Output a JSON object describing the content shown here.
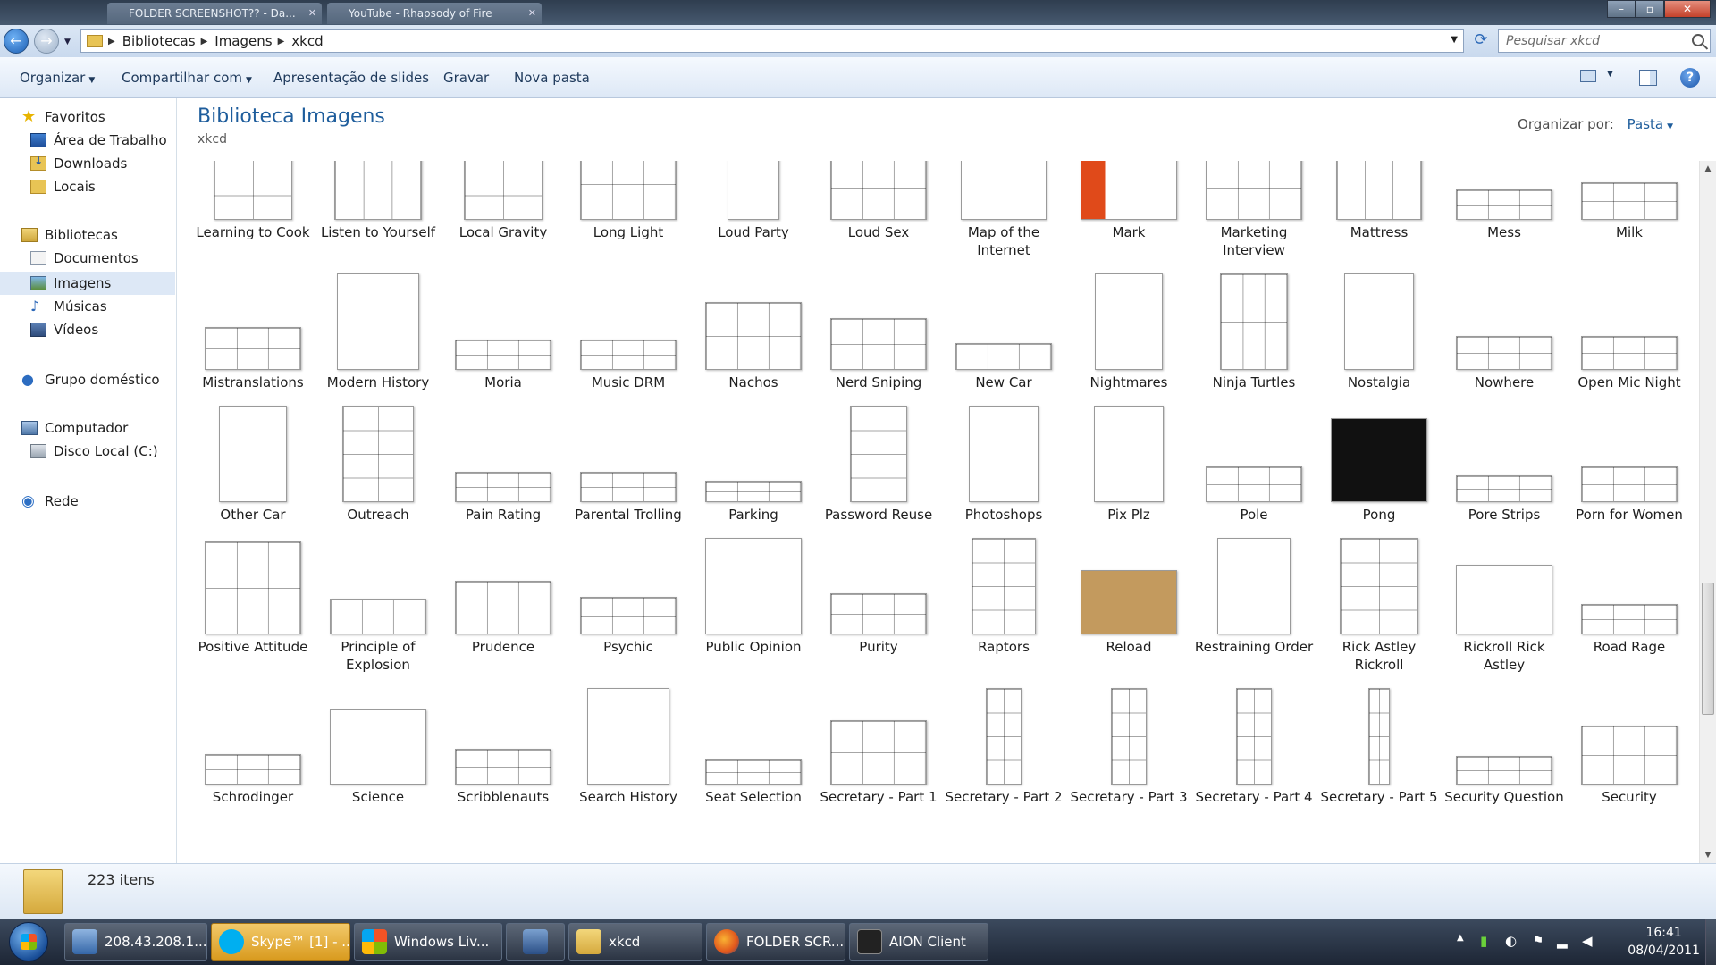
{
  "browser_tabs": [
    {
      "label": "FOLDER SCREENSHOT?? - Da..."
    },
    {
      "label": "YouTube - Rhapsody of Fire"
    }
  ],
  "address": {
    "crumbs": [
      "Bibliotecas",
      "Imagens",
      "xkcd"
    ],
    "search_placeholder": "Pesquisar xkcd"
  },
  "toolbar": {
    "organize": "Organizar",
    "share": "Compartilhar com",
    "slideshow": "Apresentação de slides",
    "burn": "Gravar",
    "new_folder": "Nova pasta"
  },
  "sidebar": {
    "favorites": "Favoritos",
    "desktop": "Área de Trabalho",
    "downloads": "Downloads",
    "places": "Locais",
    "libraries": "Bibliotecas",
    "documents": "Documentos",
    "images": "Imagens",
    "music": "Músicas",
    "videos": "Vídeos",
    "homegroup": "Grupo doméstico",
    "computer": "Computador",
    "local_disk": "Disco Local (C:)",
    "network": "Rede"
  },
  "header": {
    "title": "Biblioteca Imagens",
    "subtitle": "xkcd",
    "arrange_label": "Organizar por:",
    "arrange_value": "Pasta"
  },
  "files": [
    [
      "Learning to Cook",
      "Listen to Yourself",
      "Local Gravity",
      "Long Light",
      "Loud Party",
      "Loud Sex",
      "Map of the Internet",
      "Mark",
      "Marketing Interview",
      "Mattress",
      "Mess",
      "Milk"
    ],
    [
      "Mistranslations",
      "Modern History",
      "Moria",
      "Music DRM",
      "Nachos",
      "Nerd Sniping",
      "New Car",
      "Nightmares",
      "Ninja Turtles",
      "Nostalgia",
      "Nowhere",
      "Open Mic Night"
    ],
    [
      "Other Car",
      "Outreach",
      "Pain Rating",
      "Parental Trolling",
      "Parking",
      "Password Reuse",
      "Photoshops",
      "Pix Plz",
      "Pole",
      "Pong",
      "Pore Strips",
      "Porn for Women"
    ],
    [
      "Positive Attitude",
      "Principle of Explosion",
      "Prudence",
      "Psychic",
      "Public Opinion",
      "Purity",
      "Raptors",
      "Reload",
      "Restraining Order",
      "Rick Astley Rickroll",
      "Rickroll Rick Astley",
      "Road Rage"
    ],
    [
      "Schrodinger",
      "Science",
      "Scribblenauts",
      "Search History",
      "Seat Selection",
      "Secretary - Part 1",
      "Secretary - Part 2",
      "Secretary - Part 3",
      "Secretary - Part 4",
      "Secretary - Part 5",
      "Security Question",
      "Security"
    ]
  ],
  "status": {
    "count": "223 itens"
  },
  "taskbar": {
    "tasks": [
      "208.43.208.1...",
      "Skype™ [1] - ...",
      "Windows Liv...",
      "",
      "xkcd",
      "FOLDER SCR...",
      "AION Client"
    ],
    "time": "16:41",
    "date": "08/04/2011"
  }
}
